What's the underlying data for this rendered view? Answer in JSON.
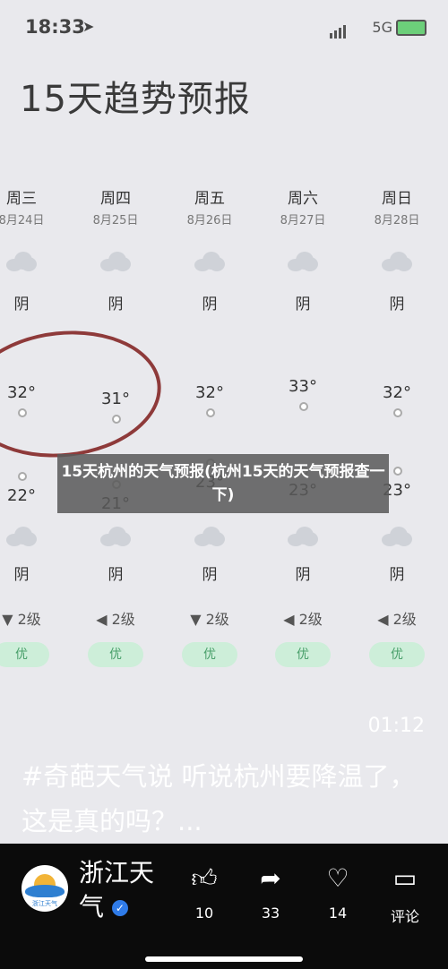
{
  "status": {
    "time": "18:33",
    "network": "5G"
  },
  "title": "15天趋势预报",
  "days": [
    {
      "day": "周三",
      "date": "8月24日",
      "cond_day": "阴",
      "high": "32°",
      "low": "22°",
      "cond_night": "阴",
      "wind": "▼ 2级",
      "aqi": "优"
    },
    {
      "day": "周四",
      "date": "8月25日",
      "cond_day": "阴",
      "high": "31°",
      "low": "21°",
      "cond_night": "阴",
      "wind": "◀ 2级",
      "aqi": "优"
    },
    {
      "day": "周五",
      "date": "8月26日",
      "cond_day": "阴",
      "high": "32°",
      "low": "23°",
      "cond_night": "阴",
      "wind": "▼ 2级",
      "aqi": "优"
    },
    {
      "day": "周六",
      "date": "8月27日",
      "cond_day": "阴",
      "high": "33°",
      "low": "23°",
      "cond_night": "阴",
      "wind": "◀ 2级",
      "aqi": "优"
    },
    {
      "day": "周日",
      "date": "8月28日",
      "cond_day": "阴",
      "high": "32°",
      "low": "23°",
      "cond_night": "阴",
      "wind": "◀ 2级",
      "aqi": "优"
    }
  ],
  "banner": "15天杭州的天气预报(杭州15天的天气预报查一下)",
  "video": {
    "duration": "01:12",
    "caption": "#奇葩天气说 听说杭州要降温了，这是真的吗？..."
  },
  "account": {
    "name": "浙江天气",
    "logo_text": "浙江天气"
  },
  "actions": {
    "likes": "10",
    "shares": "33",
    "favorites": "14",
    "comment_label": "评论"
  }
}
